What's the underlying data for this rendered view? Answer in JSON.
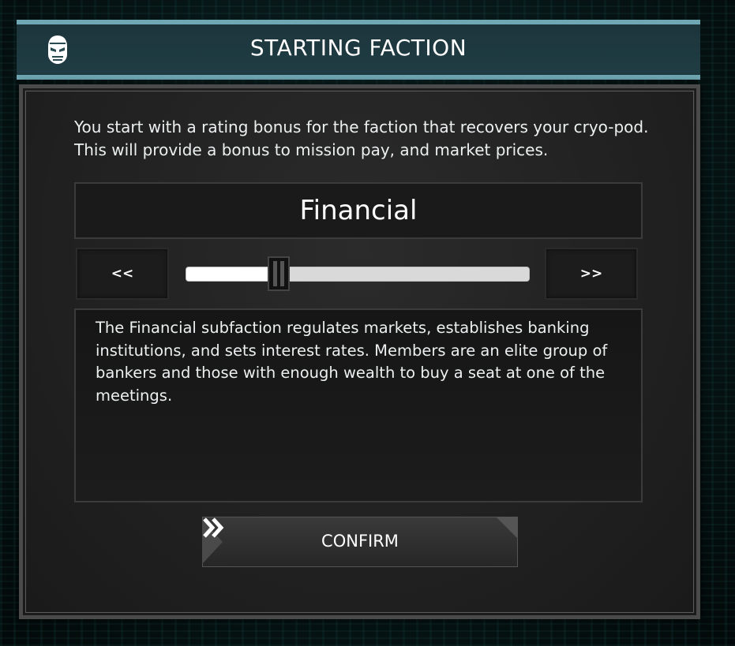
{
  "dialog": {
    "title": "STARTING FACTION",
    "title_icon": "mask-icon",
    "intro_line_1": "You start with a rating bonus for the faction that recovers your cryo-pod.",
    "intro_line_2": "This will provide a bonus to mission pay, and market prices."
  },
  "selector": {
    "selected_faction": "Financial",
    "prev_label": "<<",
    "next_label": ">>",
    "slider_position": 0.25
  },
  "description": {
    "text": "The Financial subfaction regulates markets, establishes banking institutions, and sets interest rates. Members are an elite group of bankers and those with enough wealth to buy a seat at one of the meetings."
  },
  "actions": {
    "confirm_label": "CONFIRM",
    "confirm_icon": "double-chevron-right-icon"
  },
  "colors": {
    "title_bar_accent": "#6fa7b3",
    "panel_bg": "#222222",
    "text": "#ecf0f0"
  }
}
